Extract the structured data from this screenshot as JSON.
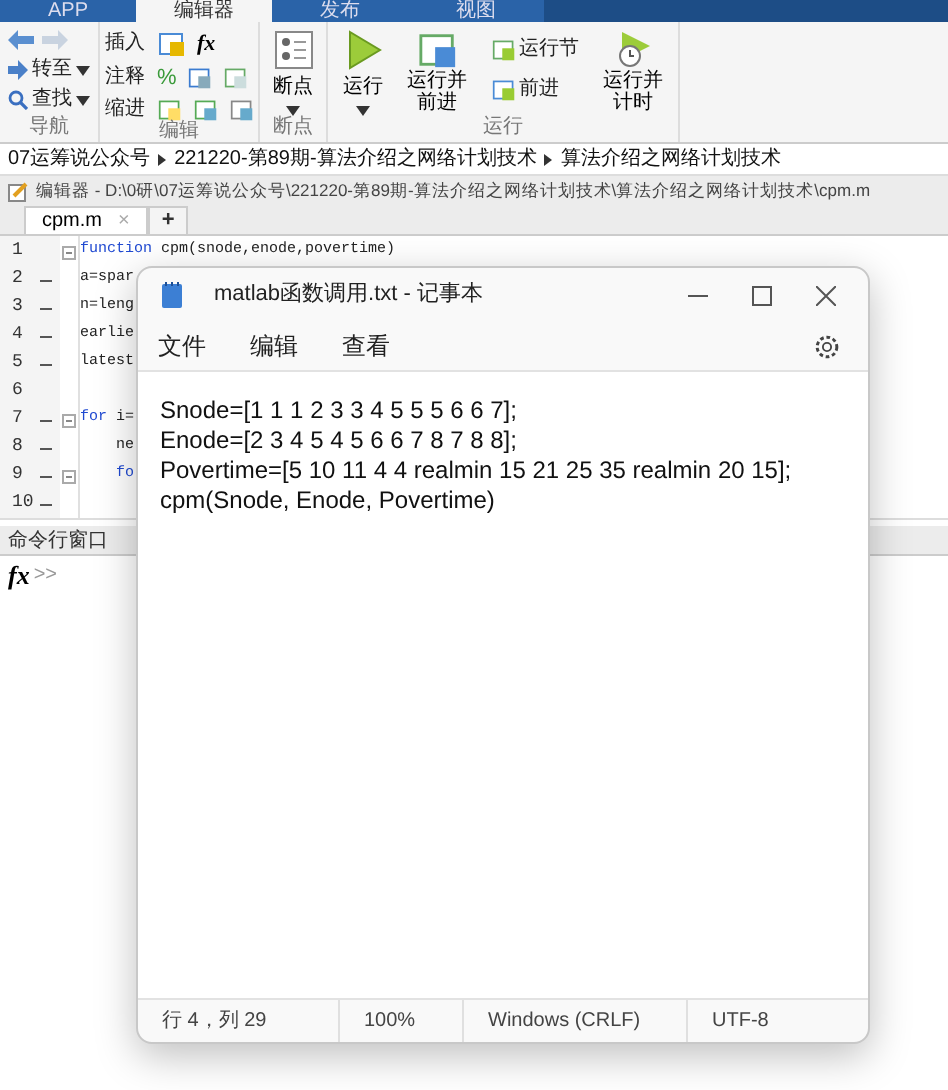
{
  "ribbon_tabs": [
    {
      "label": "APP",
      "selected": false
    },
    {
      "label": "编辑器",
      "selected": true
    },
    {
      "label": "发布",
      "selected": false
    },
    {
      "label": "视图",
      "selected": false
    }
  ],
  "navigation": {
    "label": "导航",
    "goto": "转至",
    "find": "查找",
    "forward_disabled": true
  },
  "edit": {
    "label": "编辑",
    "insert": "插入",
    "comment": "注释",
    "indent": "缩进",
    "comment_symbol": "%",
    "function_symbol": "fx"
  },
  "breakpoints": {
    "label": "断点",
    "button": "断点"
  },
  "run": {
    "label": "运行",
    "run": "运行",
    "run_advance": [
      "运行并",
      "前进"
    ],
    "run_section": "运行节",
    "advance": "前进",
    "run_time": [
      "运行并",
      "计时"
    ]
  },
  "breadcrumb": [
    "07运筹说公众号",
    "221220-第89期-算法介绍之网络计划技术",
    "算法介绍之网络计划技术"
  ],
  "editor_title": "编辑器 - D:\\0研\\07运筹说公众号\\221220-第89期-算法介绍之网络计划技术\\算法介绍之网络计划技术\\cpm.m",
  "file_tabs": [
    {
      "label": "cpm.m",
      "close": "×",
      "selected": true
    }
  ],
  "new_tab": "+",
  "code_lines": [
    {
      "number": "1",
      "executable": false,
      "fold": true,
      "keyword": "function",
      "code": " cpm(snode,enode,povertime)"
    },
    {
      "number": "2",
      "executable": true,
      "fold": false,
      "code": "a=spar"
    },
    {
      "number": "3",
      "executable": true,
      "fold": false,
      "code": "n=leng"
    },
    {
      "number": "4",
      "executable": true,
      "fold": false,
      "code": "earlie"
    },
    {
      "number": "5",
      "executable": true,
      "fold": false,
      "code": "latest"
    },
    {
      "number": "6",
      "executable": false,
      "fold": false
    },
    {
      "number": "7",
      "executable": true,
      "fold": true,
      "keyword": "for",
      "code": " i="
    },
    {
      "number": "8",
      "executable": true,
      "fold": false,
      "code": "    ne"
    },
    {
      "number": "9",
      "executable": true,
      "fold": true,
      "keyword": "    fo"
    },
    {
      "number": "10",
      "executable": true,
      "fold": false
    }
  ],
  "command_window": {
    "title": "命令行窗口",
    "fx": "fx",
    "prompt": ">>"
  },
  "notepad": {
    "title": "matlab函数调用.txt - 记事本",
    "menu": [
      "文件",
      "编辑",
      "查看"
    ],
    "lines": [
      "Snode=[1 1 1 2 3 3 4 5 5 5 6 6 7];",
      "Enode=[2 3 4 5 4 5 6 6 7 8 7 8 8];",
      "Povertime=[5 10 11 4 4 realmin 15 21 25 35 realmin 20 15];",
      "cpm(Snode, Enode, Povertime)"
    ],
    "status": [
      "行 4，列 29",
      "100%",
      "Windows (CRLF)",
      "UTF-8"
    ]
  }
}
